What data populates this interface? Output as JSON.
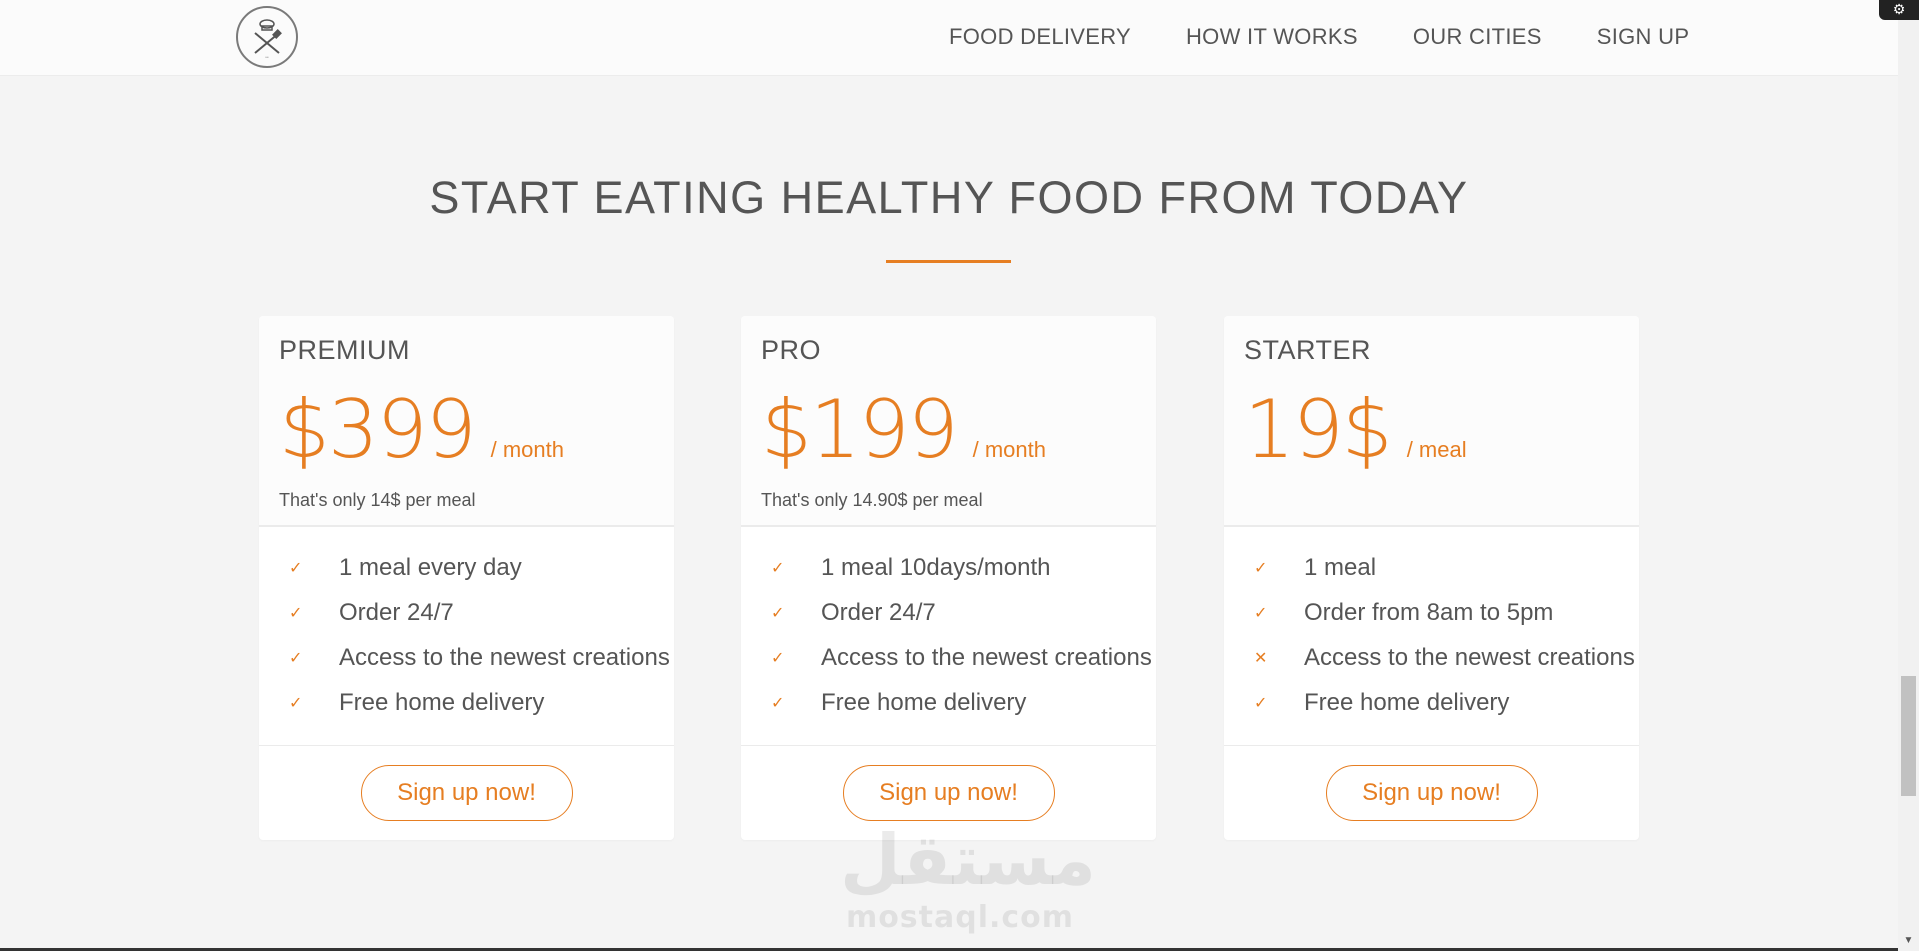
{
  "header": {
    "logo_icon": "chef-hat-utensils-logo",
    "nav": [
      {
        "label": "FOOD DELIVERY"
      },
      {
        "label": "HOW IT WORKS"
      },
      {
        "label": "OUR CITIES"
      },
      {
        "label": "SIGN UP"
      }
    ]
  },
  "section": {
    "title": "START EATING HEALTHY FOOD FROM TODAY",
    "accent_color": "#e67e22"
  },
  "plans": [
    {
      "name": "PREMIUM",
      "price": "$399",
      "per": "/ month",
      "note": "That's only 14$ per meal",
      "features": [
        {
          "text": "1 meal every day",
          "icon": "check-icon"
        },
        {
          "text": "Order 24/7",
          "icon": "check-icon"
        },
        {
          "text": "Access to the newest creations",
          "icon": "check-icon"
        },
        {
          "text": "Free home delivery",
          "icon": "check-icon"
        }
      ],
      "button": "Sign up now!"
    },
    {
      "name": "PRO",
      "price": "$199",
      "per": "/ month",
      "note": "That's only 14.90$ per meal",
      "features": [
        {
          "text": "1 meal 10days/month",
          "icon": "check-icon"
        },
        {
          "text": "Order 24/7",
          "icon": "check-icon"
        },
        {
          "text": "Access to the newest creations",
          "icon": "check-icon"
        },
        {
          "text": "Free home delivery",
          "icon": "check-icon"
        }
      ],
      "button": "Sign up now!"
    },
    {
      "name": "STARTER",
      "price": "19$",
      "per": "/ meal",
      "note": "",
      "features": [
        {
          "text": "1 meal",
          "icon": "check-icon"
        },
        {
          "text": "Order from 8am to 5pm",
          "icon": "check-icon"
        },
        {
          "text": "Access to the newest creations",
          "icon": "close-icon"
        },
        {
          "text": "Free home delivery",
          "icon": "check-icon"
        }
      ],
      "button": "Sign up now!"
    }
  ],
  "watermark": {
    "arabic": "مستقل",
    "latin": "mostaql.com"
  }
}
